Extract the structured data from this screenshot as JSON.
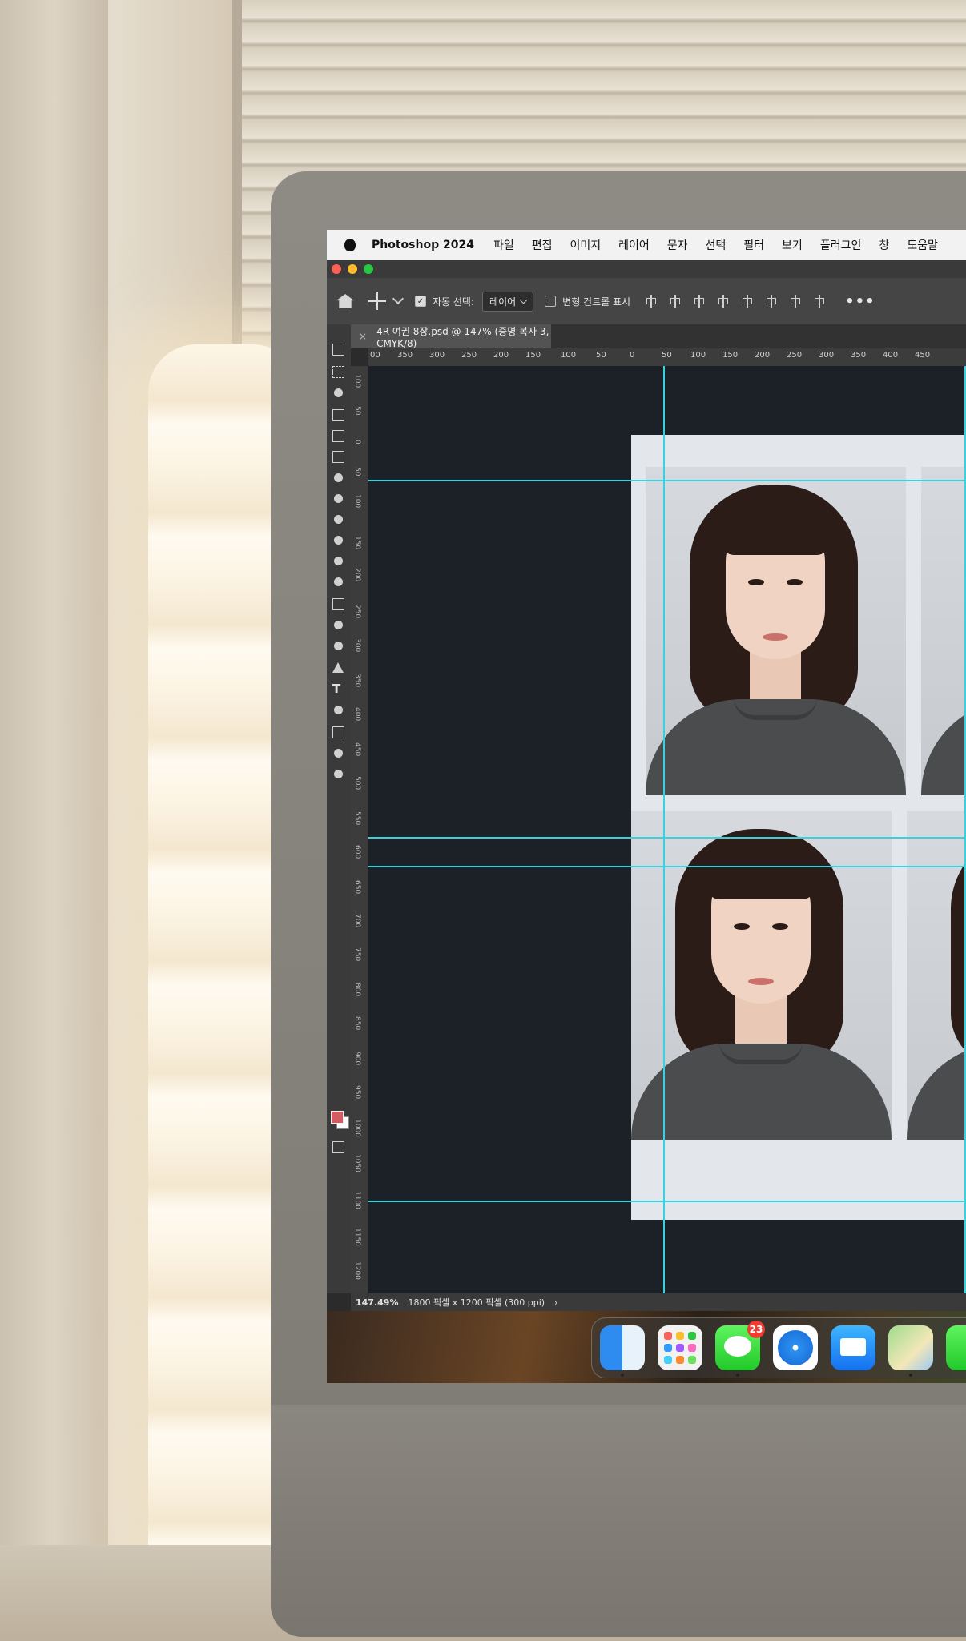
{
  "menubar": {
    "app_name": "Photoshop 2024",
    "items": [
      "파일",
      "편집",
      "이미지",
      "레이어",
      "문자",
      "선택",
      "필터",
      "보기",
      "플러그인",
      "창",
      "도움말"
    ]
  },
  "options_bar": {
    "auto_select_label": "자동 선택:",
    "auto_select_checked": true,
    "auto_select_target": "레이어",
    "transform_controls_label": "변형 컨트롤 표시",
    "transform_controls_checked": false,
    "more_label": "•••"
  },
  "document_tab": {
    "close_glyph": "×",
    "title": "4R 여권 8장.psd @ 147% (증명 복사 3, CMYK/8)"
  },
  "ruler": {
    "top_ticks": [
      "00",
      "350",
      "300",
      "250",
      "200",
      "150",
      "100",
      "50",
      "0",
      "50",
      "100",
      "150",
      "200",
      "250",
      "300",
      "350",
      "400",
      "450"
    ],
    "left_ticks": [
      "100",
      "50",
      "0",
      "50",
      "100",
      "150",
      "200",
      "250",
      "300",
      "350",
      "400",
      "450",
      "500",
      "550",
      "600",
      "650",
      "700",
      "750",
      "800",
      "850",
      "900",
      "950",
      "1000",
      "1050",
      "1100",
      "1150",
      "1200"
    ]
  },
  "status_bar": {
    "zoom": "147.49%",
    "doc_info": "1800 픽셀 x 1200 픽셀 (300 ppi)",
    "arrow": "›"
  },
  "dock": {
    "apps": [
      {
        "name": "Finder",
        "icon": "finder-icon"
      },
      {
        "name": "Launchpad",
        "icon": "launchpad-icon"
      },
      {
        "name": "Messages",
        "icon": "messages-icon",
        "badge": "23"
      },
      {
        "name": "Safari",
        "icon": "safari-icon"
      },
      {
        "name": "Mail",
        "icon": "mail-icon"
      },
      {
        "name": "Maps",
        "icon": "maps-icon"
      },
      {
        "name": "FaceTime",
        "icon": "facetime-icon"
      }
    ]
  },
  "colors": {
    "guide": "#3ad0de",
    "canvas_bg": "#1c2127",
    "foreground_swatch": "#d25c62",
    "background_swatch": "#ffffff"
  }
}
